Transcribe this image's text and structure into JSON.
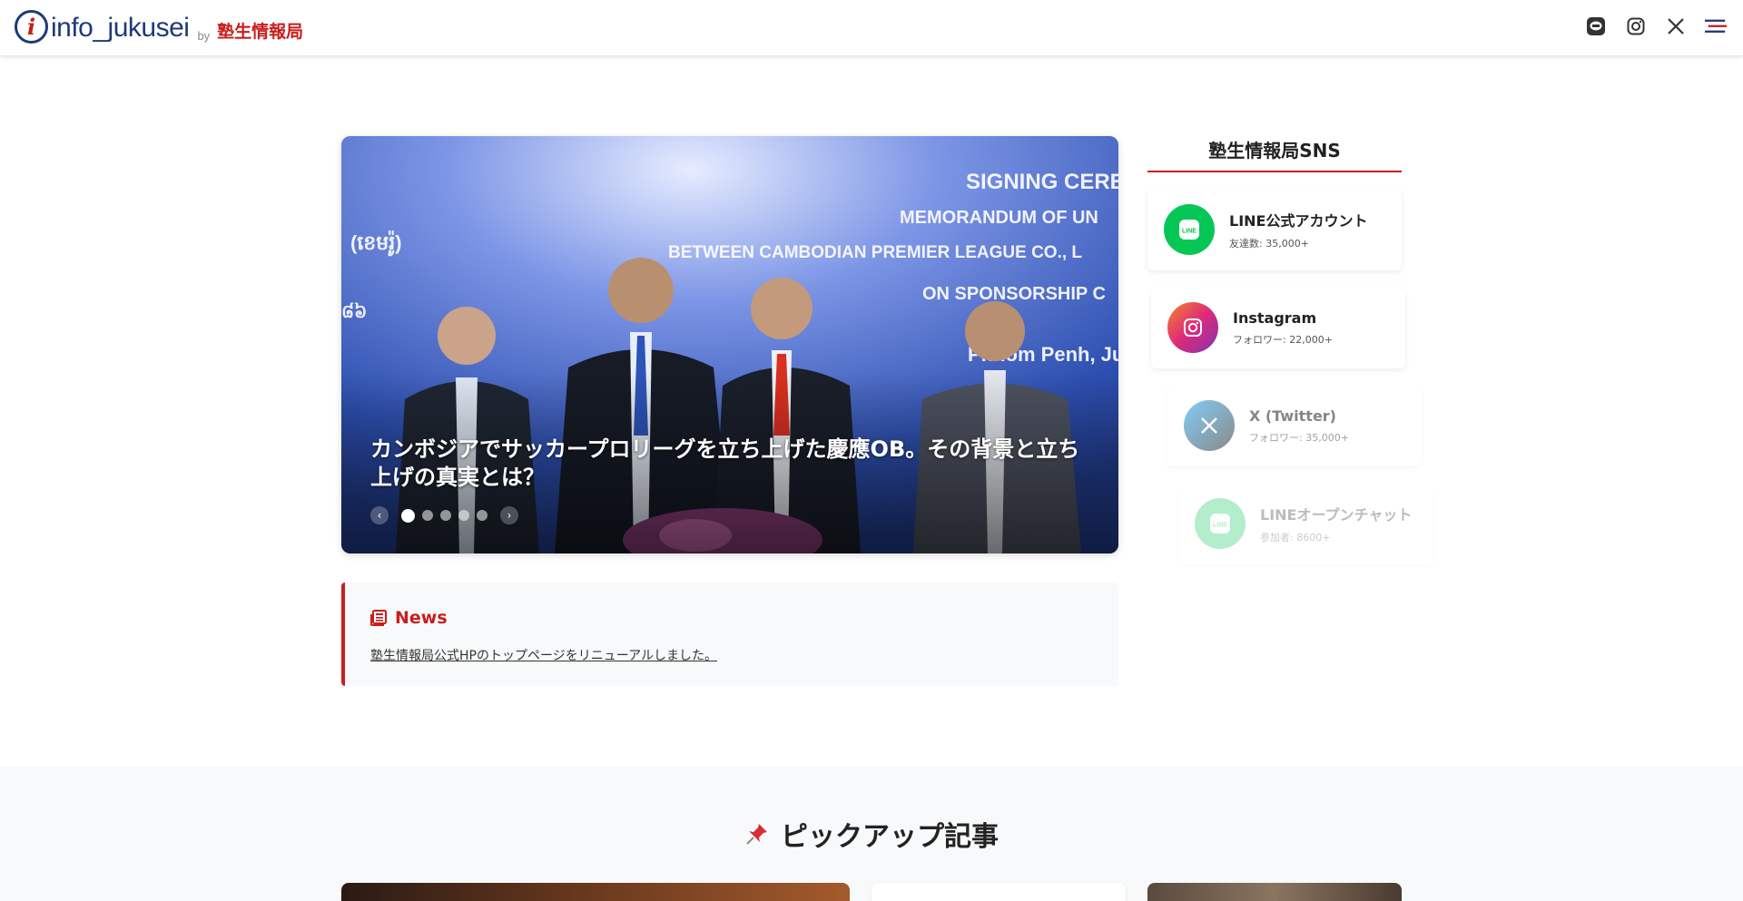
{
  "header": {
    "logo_text": "info_jukusei",
    "logo_by": "by",
    "logo_jp": "塾生情報局",
    "icons": [
      "line-icon",
      "instagram-icon",
      "x-icon",
      "menu-icon"
    ]
  },
  "slider": {
    "caption": "カンボジアでサッカープロリーグを立ち上げた慶應OB。その背景と立ち上げの真実とは？",
    "prev_label": "‹",
    "next_label": "›",
    "dot_count": 5,
    "active_index": 0,
    "banner_text": {
      "line1": "SIGNING CERE",
      "line2": "MEMORANDUM OF UN",
      "line3": "BETWEEN CAMBODIAN PREMIER LEAGUE CO., L",
      "line4": "ON SPONSORSHIP C",
      "line5": "Phnom Penh, Jun",
      "khmer_fragment_1": "(ខេមរ៉ូ)",
      "khmer_fragment_2": "៨៦"
    }
  },
  "news": {
    "title": "News",
    "items": [
      "塾生情報局公式HPのトップページをリニューアルしました。"
    ]
  },
  "sns": {
    "title": "塾生情報局SNS",
    "accounts": [
      {
        "name": "LINE公式アカウント",
        "count": "友達数: 35,000+",
        "color": "#06c755",
        "icon": "line-icon"
      },
      {
        "name": "Instagram",
        "count": "フォロワー: 22,000+",
        "color": "#d6249f",
        "icon": "instagram-icon"
      },
      {
        "name": "X (Twitter)",
        "count": "フォロワー: 35,000+",
        "color": "#1da1f2",
        "icon": "x-icon"
      },
      {
        "name": "LINEオープンチャット",
        "count": "参加者: 8600+",
        "color": "#06c755",
        "icon": "line-icon"
      }
    ]
  },
  "pickup": {
    "title": "ピックアップ記事",
    "icon": "pushpin-icon"
  },
  "colors": {
    "brand_red": "#c81e1e",
    "brand_navy": "#1e3a78"
  }
}
